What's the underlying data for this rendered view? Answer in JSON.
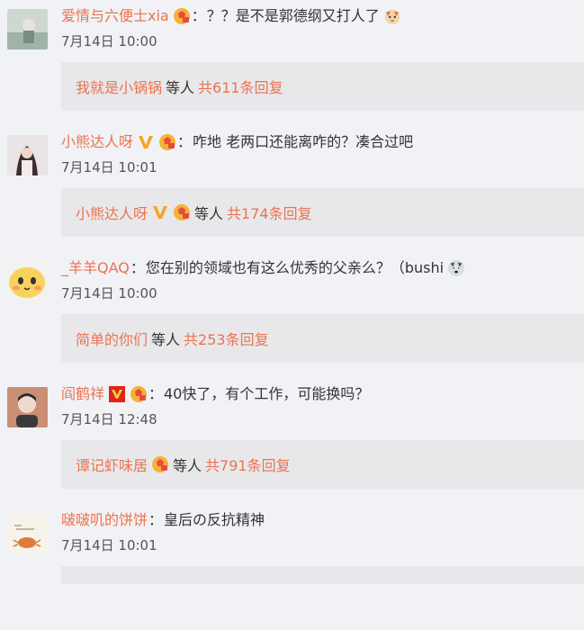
{
  "comments": [
    {
      "username": "爱情与六便士xia",
      "text": "？？是不是郭德纲又打人了",
      "time": "7月14日 10:00",
      "reply_user": "我就是小锅锅",
      "reply_suffix": "等人",
      "reply_count": "共611条回复",
      "badges": [
        "fan-badge-icon"
      ],
      "trailing_emoji": "cat-face-emoji-icon"
    },
    {
      "username": "小熊达人呀",
      "text": "咋地 老两口还能离咋的？凑合过吧",
      "time": "7月14日 10:01",
      "reply_user": "小熊达人呀",
      "reply_suffix": "等人",
      "reply_count": "共174条回复",
      "badges": [
        "verified-v-icon",
        "fan-badge-icon"
      ]
    },
    {
      "username": "_羊羊QAQ",
      "text": "您在别的领域也有这么优秀的父亲么？（bushi",
      "time": "7月14日 10:00",
      "reply_user": "简单的你们",
      "reply_suffix": "等人",
      "reply_count": "共253条回复",
      "badges": [],
      "trailing_emoji": "husky-emoji-icon"
    },
    {
      "username": "阎鹤祥",
      "text": "40快了，有个工作，可能换吗？",
      "time": "7月14日 12:48",
      "reply_user": "谭记虾味居",
      "reply_suffix": "等人",
      "reply_count": "共791条回复",
      "badges": [
        "red-v-icon",
        "fan-badge-icon"
      ]
    },
    {
      "username": "啵啵叽的饼饼",
      "text": "皇后の反抗精神",
      "time": "7月14日 10:01",
      "badges": []
    }
  ],
  "colors": {
    "username": "#eb7350",
    "background": "#f1f2f5",
    "reply_box": "#e8e8eb",
    "verified_gold": "#f5a623",
    "verified_red": "#e2231a"
  }
}
